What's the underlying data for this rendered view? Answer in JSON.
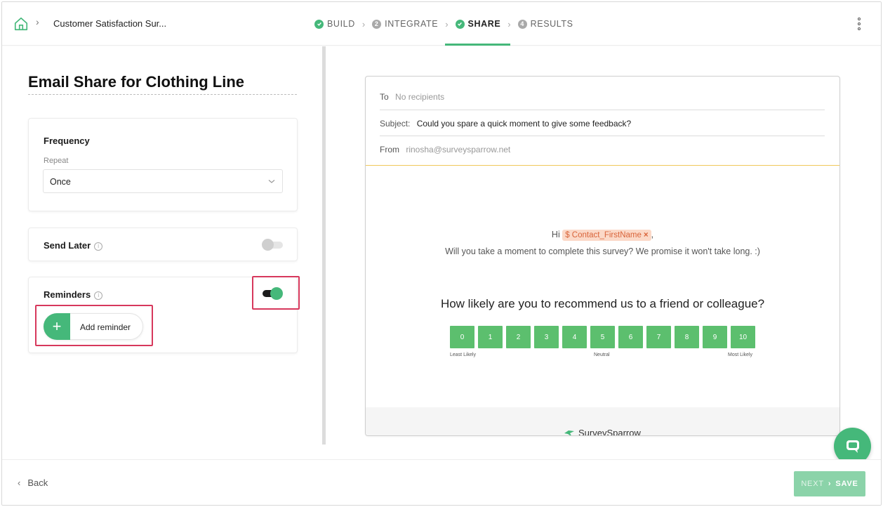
{
  "header": {
    "breadcrumb_title": "Customer Satisfaction Sur...",
    "steps": [
      {
        "label": "BUILD",
        "marker": "check"
      },
      {
        "label": "INTEGRATE",
        "marker": "2"
      },
      {
        "label": "SHARE",
        "marker": "check",
        "active": true
      },
      {
        "label": "RESULTS",
        "marker": "4"
      }
    ]
  },
  "left": {
    "title": "Email Share for Clothing Line",
    "frequency": {
      "label": "Frequency",
      "repeat_label": "Repeat",
      "repeat_value": "Once"
    },
    "send_later": {
      "label": "Send Later",
      "enabled": false
    },
    "reminders": {
      "label": "Reminders",
      "enabled": true,
      "add_label": "Add reminder"
    }
  },
  "email": {
    "to_label": "To",
    "to_value": "No recipients",
    "subject_label": "Subject:",
    "subject_value": "Could you spare a quick moment to give some feedback?",
    "from_label": "From",
    "from_value": "rinosha@surveysparrow.net",
    "greeting": "Hi",
    "merge_tag": "$ Contact_FirstName",
    "merge_tag_close": "×",
    "greeting_suffix": ",",
    "intro": "Will you take a moment to complete this survey? We promise it won't take long. :)",
    "question": "How likely are you to recommend us to a friend or colleague?",
    "scale": [
      "0",
      "1",
      "2",
      "3",
      "4",
      "5",
      "6",
      "7",
      "8",
      "9",
      "10"
    ],
    "scale_labels": {
      "low": "Least Likely",
      "mid": "Neutral",
      "high": "Most Likely"
    },
    "brand": "SurveySparrow"
  },
  "footer": {
    "back_label": "Back",
    "next_label": "NEXT",
    "save_label": "SAVE"
  },
  "colors": {
    "accent": "#45b87a",
    "highlight": "#d7385c",
    "merge_tag_bg": "#fbd9c8"
  }
}
